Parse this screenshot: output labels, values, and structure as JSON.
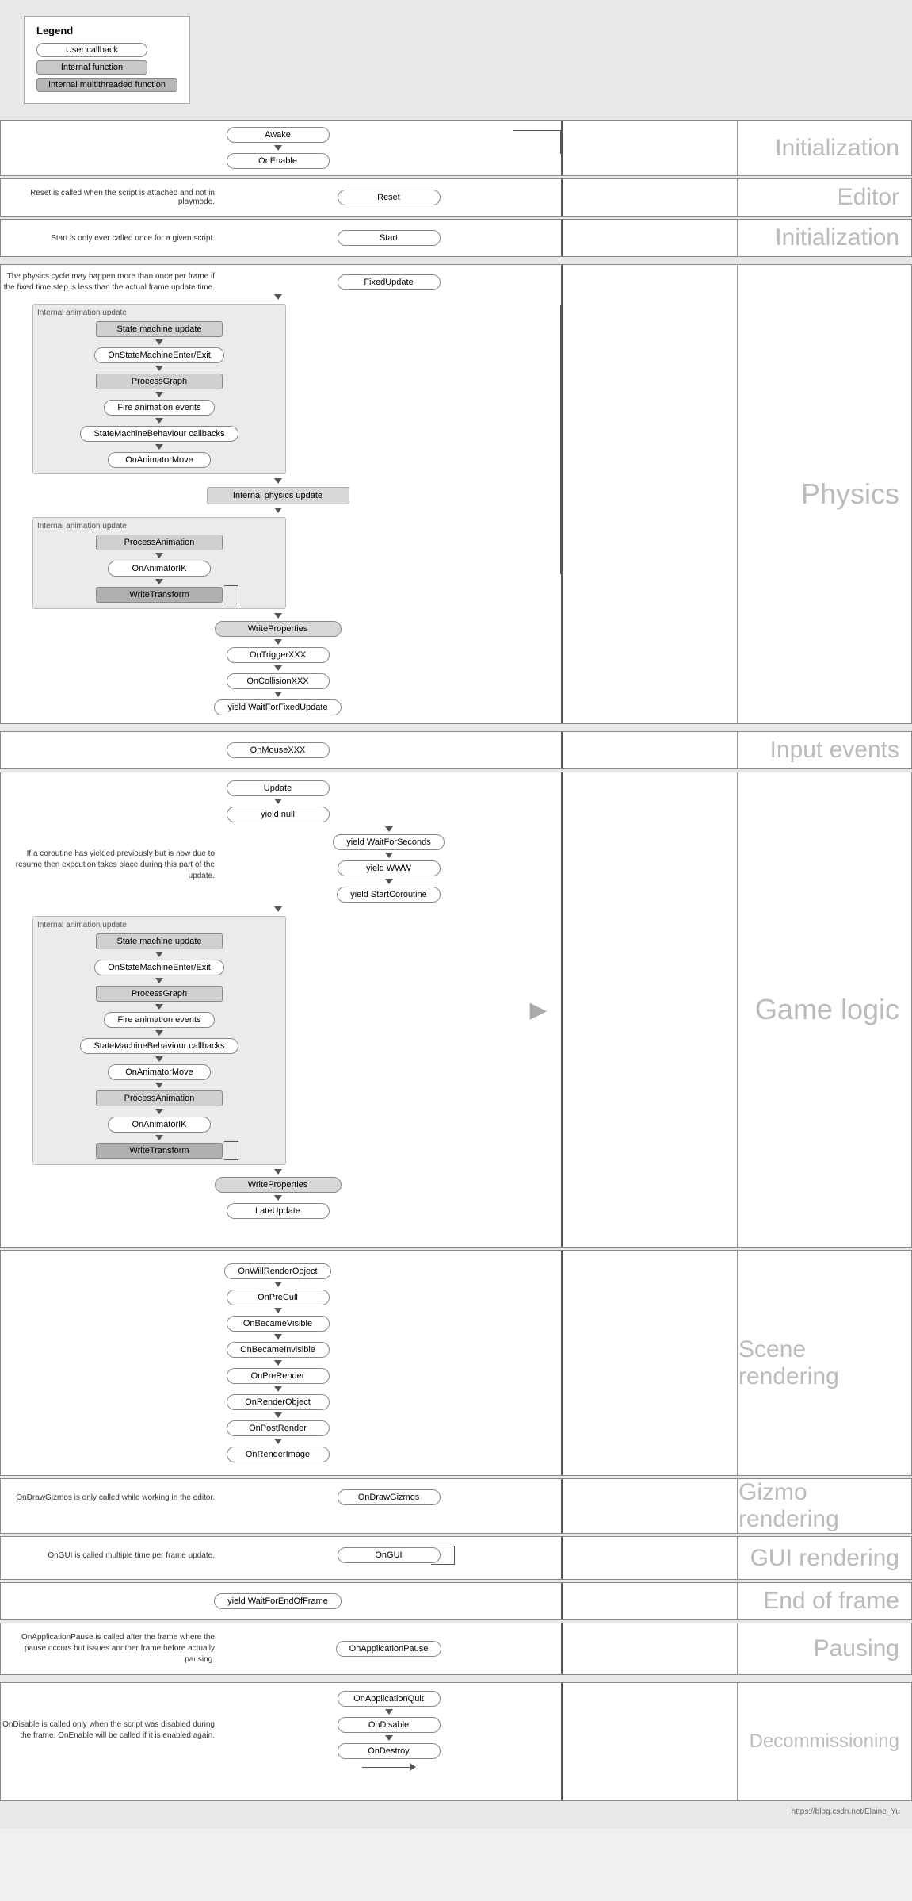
{
  "legend": {
    "title": "Legend",
    "items": [
      {
        "label": "User callback",
        "type": "pill"
      },
      {
        "label": "Internal function",
        "type": "rect"
      },
      {
        "label": "Internal multithreaded function",
        "type": "rect-dark"
      }
    ]
  },
  "sections": {
    "initialization1": {
      "label": "Initialization",
      "nodes": [
        "Awake",
        "OnEnable"
      ]
    },
    "editor": {
      "label": "Editor",
      "desc": "Reset is called when the script is attached and not in playmode.",
      "node": "Reset"
    },
    "initialization2": {
      "label": "Initialization",
      "desc": "Start is only ever called once for a given script.",
      "node": "Start"
    },
    "physics": {
      "label": "Physics",
      "fixedUpdate": "FixedUpdate",
      "internalAnimUpdate1": "Internal animation update",
      "stateMachineUpdate": "State machine update",
      "onStateMachineEnterExit": "OnStateMachineEnter/Exit",
      "processGraph": "ProcessGraph",
      "fireAnimEvents": "Fire animation events",
      "stateMachineBehaviourCallbacks": "StateMachineBehaviour callbacks",
      "onAnimatorMove": "OnAnimatorMove",
      "internalPhysicsUpdate": "Internal physics update",
      "internalAnimUpdate2": "Internal animation update",
      "processAnimation": "ProcessAnimation",
      "onAnimatorIK": "OnAnimatorIK",
      "writeTransform": "WriteTransform",
      "writeProperties": "WriteProperties",
      "onTriggerXXX": "OnTriggerXXX",
      "onCollisionXXX": "OnCollisionXXX",
      "yieldWaitForFixedUpdate": "yield WaitForFixedUpdate",
      "physicsDesc": "The physics cycle may happen more than once per frame if the fixed time step is less than the actual frame update time."
    },
    "inputEvents": {
      "label": "Input events",
      "node": "OnMouseXXX"
    },
    "gameLogic": {
      "label": "Game logic",
      "update": "Update",
      "yieldNull": "yield null",
      "yieldWaitForSeconds": "yield WaitForSeconds",
      "yieldWWW": "yield WWW",
      "yieldStartCoroutine": "yield StartCoroutine",
      "internalAnimUpdate": "Internal animation update",
      "stateMachineUpdate": "State machine update",
      "onStateMachineEnterExit": "OnStateMachineEnter/Exit",
      "processGraph": "ProcessGraph",
      "fireAnimEvents": "Fire animation events",
      "stateMachineBehaviourCallbacks": "StateMachineBehaviour callbacks",
      "onAnimatorMove": "OnAnimatorMove",
      "processAnimation": "ProcessAnimation",
      "onAnimatorIK": "OnAnimatorIK",
      "writeTransform": "WriteTransform",
      "writeProperties": "WriteProperties",
      "lateUpdate": "LateUpdate",
      "coroutineDesc": "If a coroutine has yielded previously but is now due to resume then execution takes place during this part of the update."
    },
    "sceneRendering": {
      "label": "Scene rendering",
      "nodes": [
        "OnWillRenderObject",
        "OnPreCull",
        "OnBecameVisible",
        "OnBecameInvisible",
        "OnPreRender",
        "OnRenderObject",
        "OnPostRender",
        "OnRenderImage"
      ]
    },
    "gizmoRendering": {
      "label": "Gizmo rendering",
      "desc": "OnDrawGizmos is only called while working in the editor.",
      "node": "OnDrawGizmos"
    },
    "guiRendering": {
      "label": "GUI rendering",
      "desc": "OnGUI is called multiple time per frame update.",
      "node": "OnGUI"
    },
    "endOfFrame": {
      "label": "End of frame",
      "node": "yield WaitForEndOfFrame"
    },
    "pausing": {
      "label": "Pausing",
      "desc": "OnApplicationPause is called after the frame where the pause occurs but issues another frame before actually pausing.",
      "node": "OnApplicationPause"
    },
    "decommissioning": {
      "label": "Decommissioning",
      "desc": "OnDisable is called only when the script was disabled during the frame. OnEnable will be called if it is enabled again.",
      "nodes": [
        "OnApplicationQuit",
        "OnDisable",
        "OnDestroy"
      ]
    }
  },
  "footer": {
    "url": "https://blog.csdn.net/Elaine_Yu"
  }
}
